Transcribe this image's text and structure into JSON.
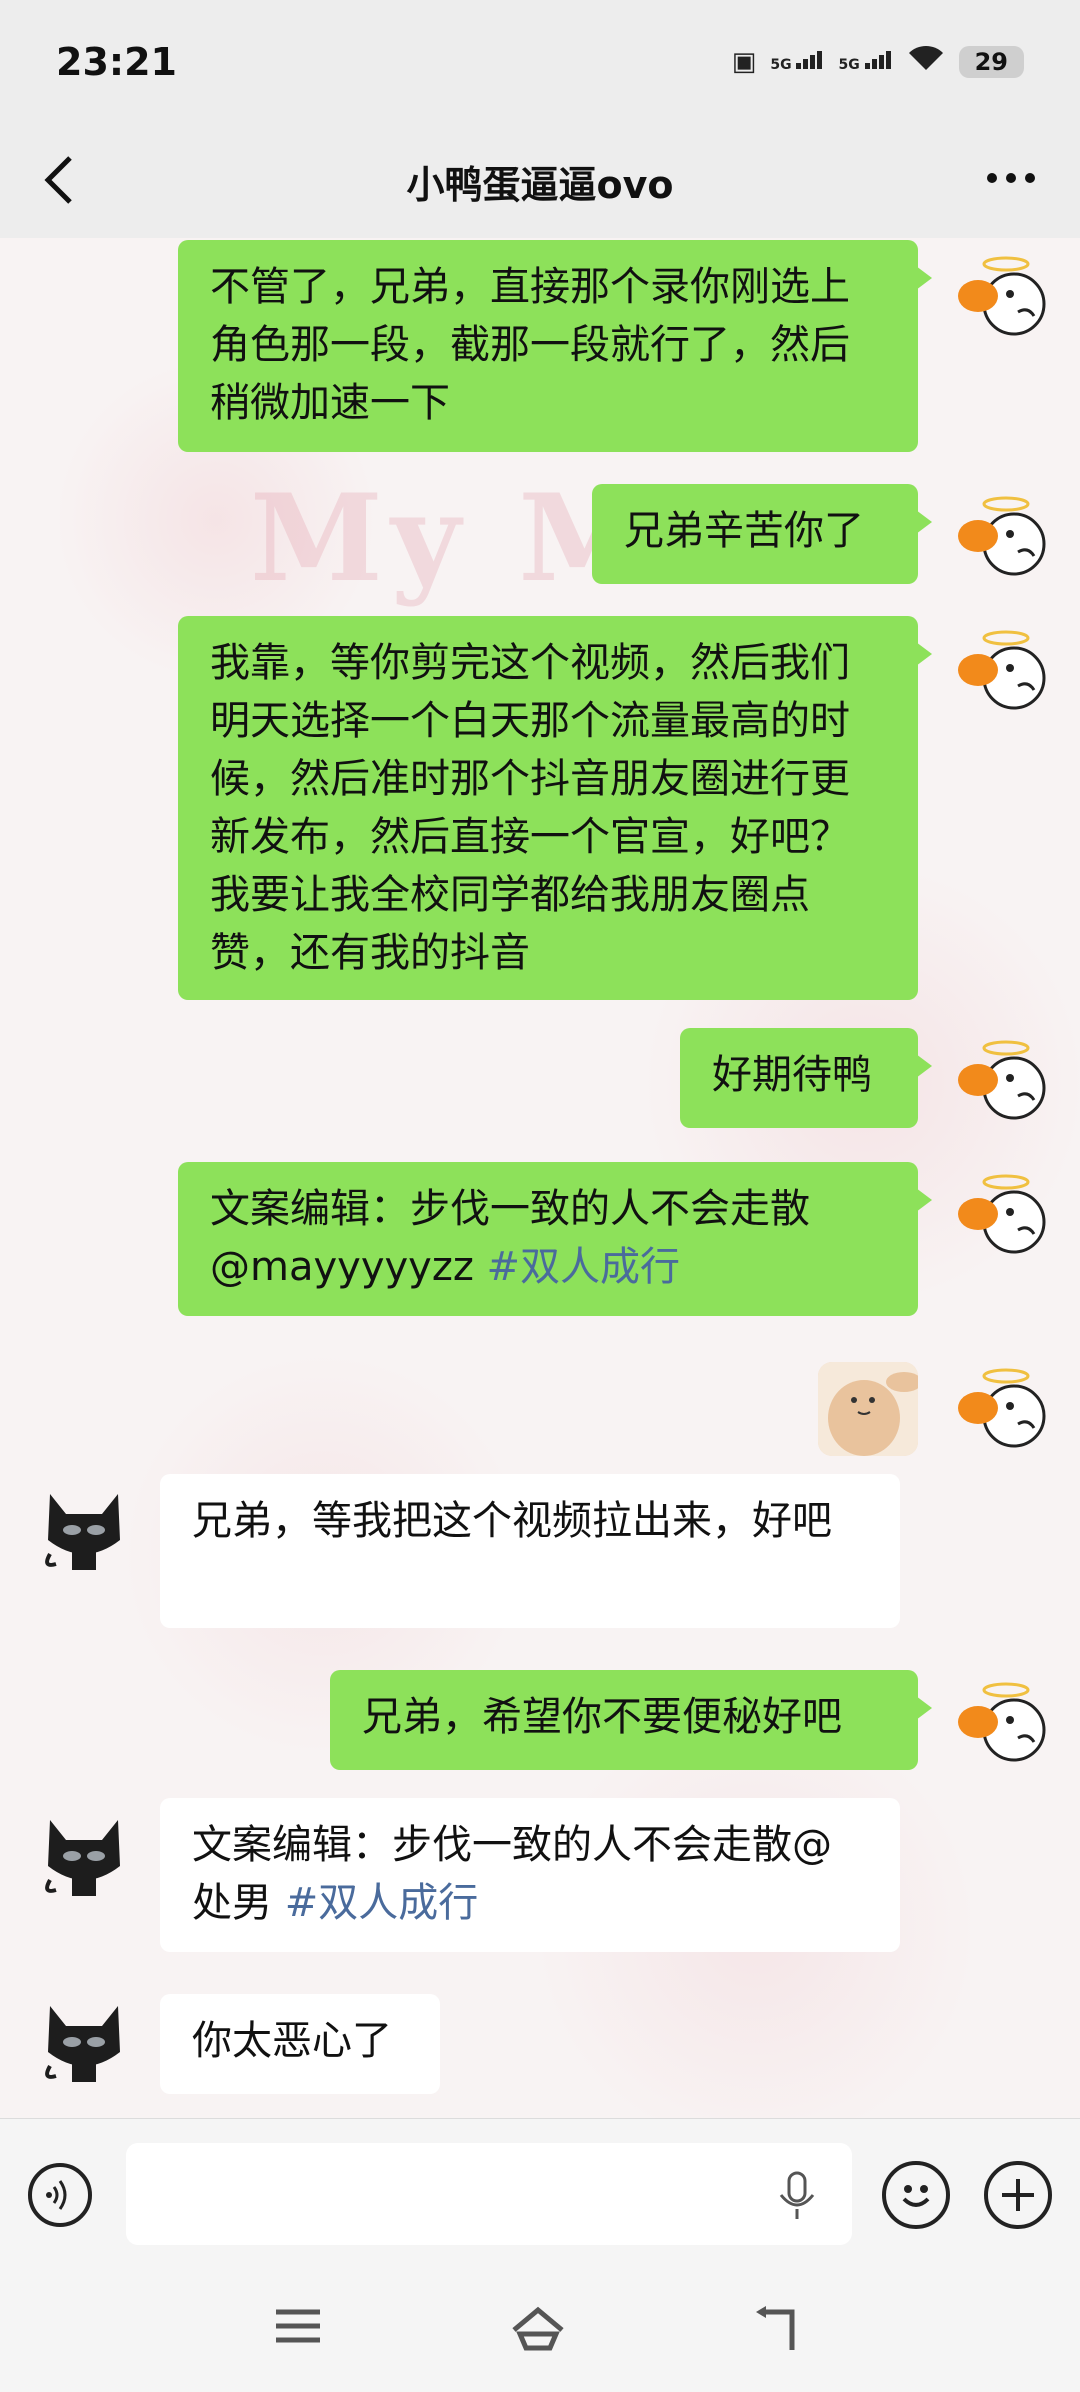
{
  "status": {
    "time": "23:21",
    "sim1": "5G",
    "sim2": "5G",
    "battery": "29"
  },
  "header": {
    "title": "小鸭蛋逼逼ovo"
  },
  "messages": [
    {
      "side": "out",
      "text": "不管了，兄弟，直接那个录你刚选上角色那一段，截那一段就行了，然后稍微加速一下"
    },
    {
      "side": "out",
      "text": "兄弟辛苦你了"
    },
    {
      "side": "out",
      "text": "我靠，等你剪完这个视频，然后我们明天选择一个白天那个流量最高的时候，然后准时那个抖音朋友圈进行更新发布，然后直接一个官宣，好吧？我要让我全校同学都给我朋友圈点赞，还有我的抖音"
    },
    {
      "side": "out",
      "text": "好期待鸭"
    },
    {
      "side": "out",
      "text": "文案编辑：步伐一致的人不会走散@mayyyyyzz ",
      "tag": "#双人成行"
    },
    {
      "side": "in",
      "text": "兄弟，等我把这个视频拉出来，好吧"
    },
    {
      "side": "out",
      "text": "兄弟，希望你不要便秘好吧"
    },
    {
      "side": "in",
      "text": "文案编辑：步伐一致的人不会走散@处男 ",
      "tag": "#双人成行"
    },
    {
      "side": "in",
      "text": "你太恶心了"
    }
  ],
  "icons": {
    "back": "chevron-left-icon",
    "more": "more-icon",
    "voice": "voice-icon",
    "mic": "microphone-icon",
    "emoji": "emoji-icon",
    "add": "plus-icon",
    "nav_menu": "menu-icon",
    "nav_home": "home-icon",
    "nav_back": "back-icon"
  },
  "colors": {
    "outgoing_bubble": "#8de15a",
    "incoming_bubble": "#ffffff",
    "hashtag": "#4a6b9c",
    "bar_background": "#ededed"
  }
}
